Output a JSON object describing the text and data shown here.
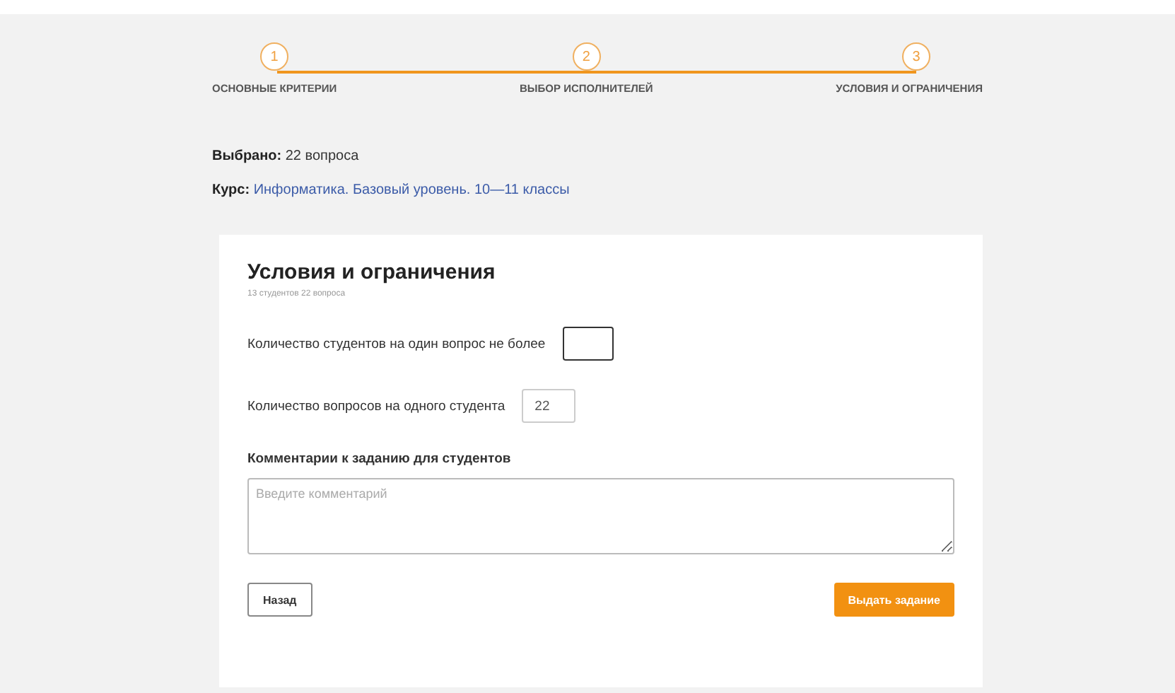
{
  "steps": [
    {
      "number": "1",
      "label": "ОСНОВНЫЕ КРИТЕРИИ"
    },
    {
      "number": "2",
      "label": "ВЫБОР ИСПОЛНИТЕЛЕЙ"
    },
    {
      "number": "3",
      "label": "УСЛОВИЯ И ОГРАНИЧЕНИЯ"
    }
  ],
  "summary": {
    "selected_label": "Выбрано:",
    "selected_value": "22 вопроса",
    "course_label": "Курс:",
    "course_link": "Информатика. Базовый уровень. 10—11 классы"
  },
  "card": {
    "title": "Условия и ограничения",
    "subtitle": "13 студентов 22 вопроса",
    "fields": [
      {
        "label": "Количество студентов на один вопрос не более",
        "focused": true
      },
      {
        "label": "Количество вопросов на одного студента",
        "value": "22",
        "focused": false
      }
    ],
    "comment": {
      "label": "Комментарии к заданию для студентов",
      "placeholder": "Введите комментарий"
    },
    "buttons": [
      {
        "label": "Назад",
        "kind": "secondary"
      },
      {
        "label": "Выдать задание",
        "kind": "primary"
      }
    ]
  }
}
